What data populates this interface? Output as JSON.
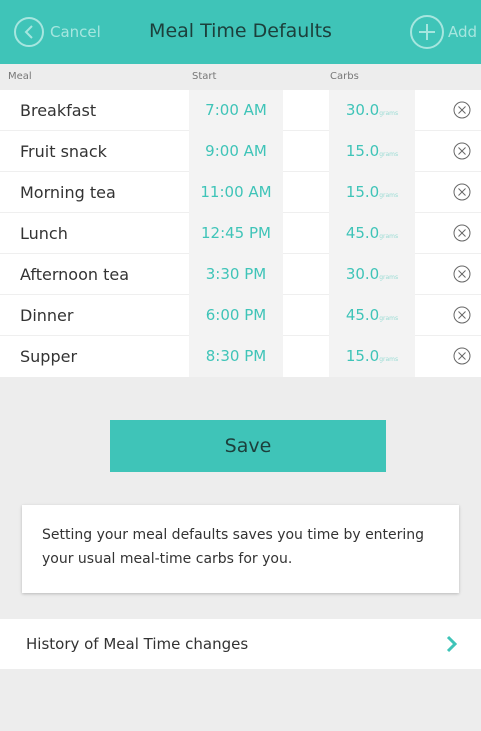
{
  "navbar": {
    "cancel_label": "Cancel",
    "title": "Meal Time Defaults",
    "add_label": "Add"
  },
  "columns": {
    "meal": "Meal",
    "start": "Start",
    "carbs": "Carbs"
  },
  "meals": [
    {
      "name": "Breakfast",
      "start": "7:00 AM",
      "carbs": "30.0",
      "unit": "grams"
    },
    {
      "name": "Fruit snack",
      "start": "9:00 AM",
      "carbs": "15.0",
      "unit": "grams"
    },
    {
      "name": "Morning tea",
      "start": "11:00 AM",
      "carbs": "15.0",
      "unit": "grams"
    },
    {
      "name": "Lunch",
      "start": "12:45 PM",
      "carbs": "45.0",
      "unit": "grams"
    },
    {
      "name": "Afternoon tea",
      "start": "3:30 PM",
      "carbs": "30.0",
      "unit": "grams"
    },
    {
      "name": "Dinner",
      "start": "6:00 PM",
      "carbs": "45.0",
      "unit": "grams"
    },
    {
      "name": "Supper",
      "start": "8:30 PM",
      "carbs": "15.0",
      "unit": "grams"
    }
  ],
  "save_label": "Save",
  "info_text": "Setting your meal defaults saves you time by entering your usual meal-time carbs for you.",
  "history_label": "History of Meal Time changes",
  "colors": {
    "accent": "#3fc4b8",
    "title_text": "#1c3f3b",
    "background": "#ededed"
  }
}
